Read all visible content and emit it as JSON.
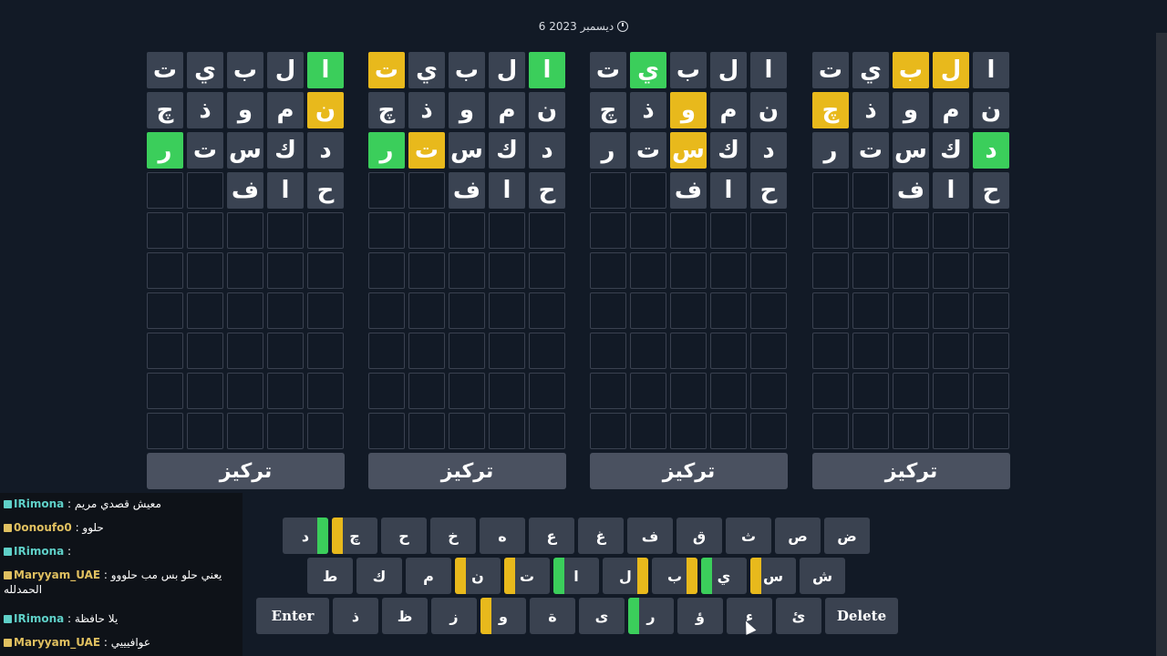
{
  "date": "6 ديسمبر 2023",
  "colors": {
    "green": "#3bce5b",
    "yellow": "#e8b91c",
    "tile": "#3a4352",
    "key": "#3a4250"
  },
  "boards": [
    {
      "focus_label": "تركيز",
      "rows": [
        [
          [
            "ا",
            "g"
          ],
          [
            "ل",
            "n"
          ],
          [
            "ب",
            "n"
          ],
          [
            "ي",
            "n"
          ],
          [
            "ت",
            "n"
          ]
        ],
        [
          [
            "ن",
            "y"
          ],
          [
            "م",
            "n"
          ],
          [
            "و",
            "n"
          ],
          [
            "ذ",
            "n"
          ],
          [
            "چ",
            "n"
          ]
        ],
        [
          [
            "د",
            "n"
          ],
          [
            "ك",
            "n"
          ],
          [
            "س",
            "n"
          ],
          [
            "ت",
            "n"
          ],
          [
            "ر",
            "g"
          ]
        ],
        [
          [
            "ح",
            "n"
          ],
          [
            "ا",
            "n"
          ],
          [
            "ف",
            "n"
          ],
          [
            "",
            ""
          ],
          [
            "",
            ""
          ]
        ]
      ]
    },
    {
      "focus_label": "تركيز",
      "rows": [
        [
          [
            "ا",
            "g"
          ],
          [
            "ل",
            "n"
          ],
          [
            "ب",
            "n"
          ],
          [
            "ي",
            "n"
          ],
          [
            "ت",
            "y"
          ]
        ],
        [
          [
            "ن",
            "n"
          ],
          [
            "م",
            "n"
          ],
          [
            "و",
            "n"
          ],
          [
            "ذ",
            "n"
          ],
          [
            "چ",
            "n"
          ]
        ],
        [
          [
            "د",
            "n"
          ],
          [
            "ك",
            "n"
          ],
          [
            "س",
            "n"
          ],
          [
            "ت",
            "y"
          ],
          [
            "ر",
            "g"
          ]
        ],
        [
          [
            "ح",
            "n"
          ],
          [
            "ا",
            "n"
          ],
          [
            "ف",
            "n"
          ],
          [
            "",
            ""
          ],
          [
            "",
            ""
          ]
        ]
      ]
    },
    {
      "focus_label": "تركيز",
      "rows": [
        [
          [
            "ا",
            "n"
          ],
          [
            "ل",
            "n"
          ],
          [
            "ب",
            "n"
          ],
          [
            "ي",
            "g"
          ],
          [
            "ت",
            "n"
          ]
        ],
        [
          [
            "ن",
            "n"
          ],
          [
            "م",
            "n"
          ],
          [
            "و",
            "y"
          ],
          [
            "ذ",
            "n"
          ],
          [
            "چ",
            "n"
          ]
        ],
        [
          [
            "د",
            "n"
          ],
          [
            "ك",
            "n"
          ],
          [
            "س",
            "y"
          ],
          [
            "ت",
            "n"
          ],
          [
            "ر",
            "n"
          ]
        ],
        [
          [
            "ح",
            "n"
          ],
          [
            "ا",
            "n"
          ],
          [
            "ف",
            "n"
          ],
          [
            "",
            ""
          ],
          [
            "",
            ""
          ]
        ]
      ]
    },
    {
      "focus_label": "تركيز",
      "rows": [
        [
          [
            "ا",
            "n"
          ],
          [
            "ل",
            "y"
          ],
          [
            "ب",
            "y"
          ],
          [
            "ي",
            "n"
          ],
          [
            "ت",
            "n"
          ]
        ],
        [
          [
            "ن",
            "n"
          ],
          [
            "م",
            "n"
          ],
          [
            "و",
            "n"
          ],
          [
            "ذ",
            "n"
          ],
          [
            "چ",
            "y"
          ]
        ],
        [
          [
            "د",
            "g"
          ],
          [
            "ك",
            "n"
          ],
          [
            "س",
            "n"
          ],
          [
            "ت",
            "n"
          ],
          [
            "ر",
            "n"
          ]
        ],
        [
          [
            "ح",
            "n"
          ],
          [
            "ا",
            "n"
          ],
          [
            "ف",
            "n"
          ],
          [
            "",
            ""
          ],
          [
            "",
            ""
          ]
        ]
      ]
    }
  ],
  "keyboard": {
    "rows": [
      [
        "ض",
        "ص",
        "ث",
        "ق",
        "ف",
        "غ",
        "ع",
        "ه",
        "خ",
        "ح",
        "چ",
        "د"
      ],
      [
        "ش",
        "س",
        "ي",
        "ب",
        "ل",
        "ا",
        "ت",
        "ن",
        "م",
        "ك",
        "ط"
      ],
      [
        "Delete",
        "ئ",
        "ء",
        "ؤ",
        "ر",
        "ى",
        "ة",
        "و",
        "ز",
        "ظ",
        "ذ",
        "Enter"
      ]
    ],
    "marks": {
      "چ": [
        [
          "y",
          0
        ]
      ],
      "د": [
        [
          "g",
          3
        ]
      ],
      "س": [
        [
          "y",
          0
        ]
      ],
      "ي": [
        [
          "g",
          0
        ]
      ],
      "ب": [
        [
          "y",
          3
        ]
      ],
      "ل": [
        [
          "y",
          3
        ]
      ],
      "ا": [
        [
          "g",
          0
        ]
      ],
      "ت": [
        [
          "y",
          0
        ]
      ],
      "ن": [
        [
          "y",
          0
        ]
      ],
      "ر": [
        [
          "g",
          0
        ]
      ],
      "و": [
        [
          "y",
          0
        ]
      ]
    }
  },
  "chat": [
    {
      "user": "IRimona",
      "text": "معيش قصدي مريم",
      "color": "#5fd0c8"
    },
    {
      "user": "0onoufo0",
      "text": "حلوو",
      "color": "#e0c060"
    },
    {
      "user": "IRimona",
      "text": "",
      "color": "#5fd0c8"
    },
    {
      "user": "Maryyam_UAE",
      "text": "يعني حلو بس مب حلووو",
      "text2": "الحمدلله",
      "color": "#e0c060"
    },
    {
      "user": "IRimona",
      "text": "يلا حافظة",
      "color": "#5fd0c8"
    },
    {
      "user": "Maryyam_UAE",
      "text": "عوافيييي",
      "color": "#e0c060"
    }
  ]
}
